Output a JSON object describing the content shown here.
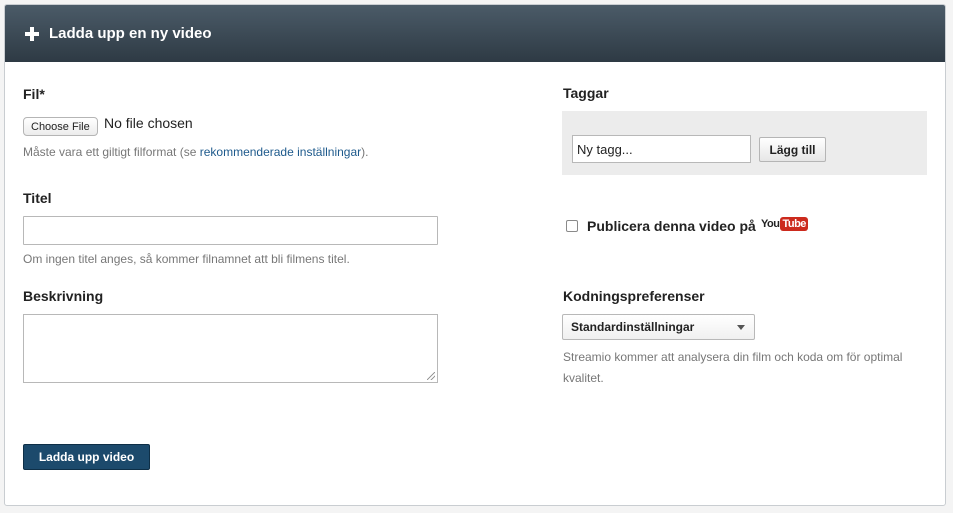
{
  "header": {
    "title": "Ladda upp en ny video",
    "icon": "plus-icon"
  },
  "file": {
    "label": "Fil*",
    "choose_button": "Choose File",
    "status": "No file chosen",
    "hint_prefix": "Måste vara ett giltigt filformat (se ",
    "hint_link": "rekommenderade inställningar",
    "hint_suffix": ")."
  },
  "title_field": {
    "label": "Titel",
    "value": "",
    "hint": "Om ingen titel anges, så kommer filnamnet att bli filmens titel."
  },
  "description": {
    "label": "Beskrivning",
    "value": ""
  },
  "submit": {
    "label": "Ladda upp video"
  },
  "tags": {
    "label": "Taggar",
    "input_value": "Ny tagg...",
    "add_button": "Lägg till"
  },
  "publish": {
    "label": "Publicera denna video på",
    "checked": false,
    "logo_you": "You",
    "logo_tube": "Tube"
  },
  "encoding": {
    "label": "Kodningspreferenser",
    "selected": "Standardinställningar",
    "hint": "Streamio kommer att analysera din film och koda om för optimal kvalitet."
  },
  "colors": {
    "header_bg": "#34424e",
    "primary_button": "#1c4a6c",
    "link": "#1e5a8c",
    "youtube_red": "#cc2a1d"
  }
}
